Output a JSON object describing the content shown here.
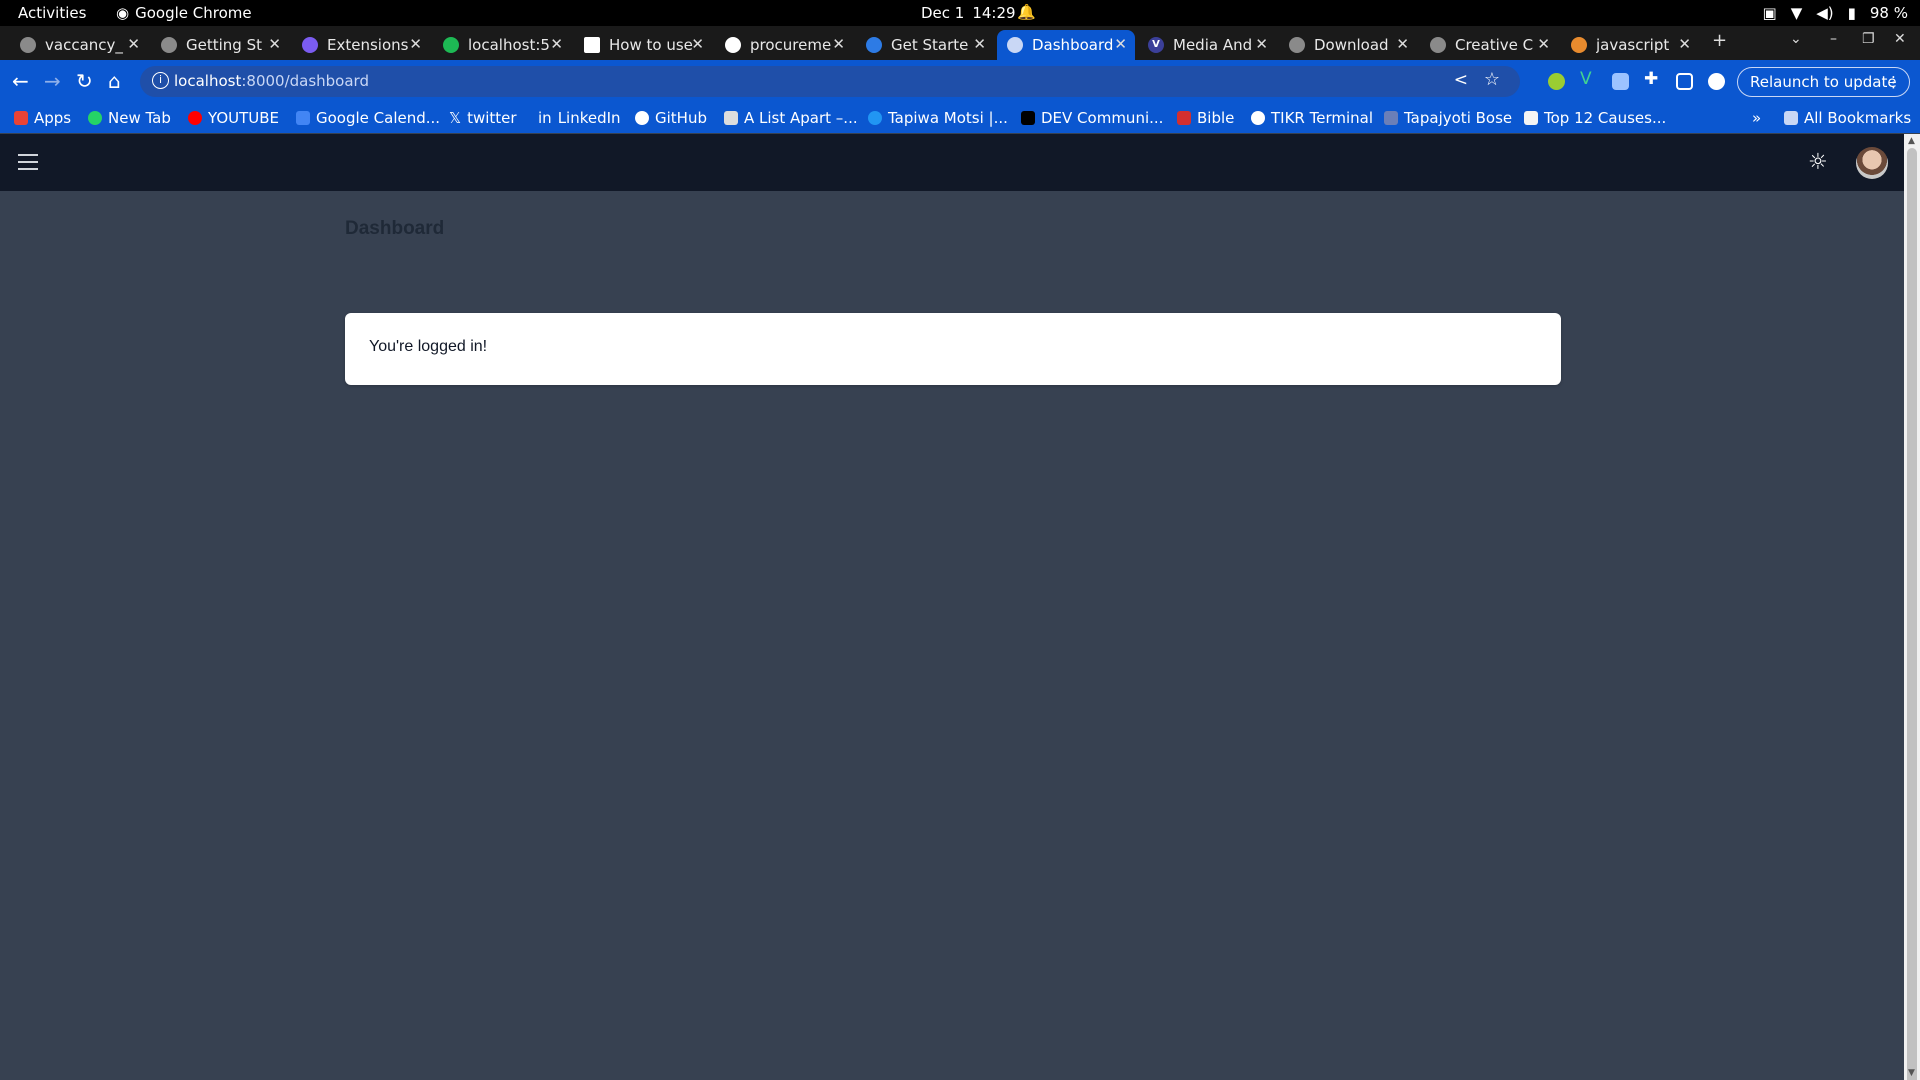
{
  "os_bar": {
    "activities": "Activities",
    "app_name": "Google Chrome",
    "date": "Dec 1",
    "time": "14:29",
    "battery": "98 %"
  },
  "tabs": [
    {
      "title": "vaccancy_",
      "active": false
    },
    {
      "title": "Getting St",
      "active": false
    },
    {
      "title": "Extensions",
      "active": false
    },
    {
      "title": "localhost:5",
      "active": false
    },
    {
      "title": "How to use",
      "active": false
    },
    {
      "title": "procureme",
      "active": false
    },
    {
      "title": "Get Starte",
      "active": false
    },
    {
      "title": "Dashboard",
      "active": true
    },
    {
      "title": "Media And",
      "active": false
    },
    {
      "title": "Download",
      "active": false
    },
    {
      "title": "Creative C",
      "active": false
    },
    {
      "title": "javascript",
      "active": false
    }
  ],
  "address_bar": {
    "host": "localhost",
    "path": ":8000/dashboard"
  },
  "relaunch_label": "Relaunch to update",
  "bookmarks": {
    "items": [
      "Apps",
      "New Tab",
      "YOUTUBE",
      "Google Calend...",
      "twitter",
      "LinkedIn",
      "GitHub",
      "A List Apart –...",
      "Tapiwa Motsi |...",
      "DEV Communi...",
      "Bible",
      "TIKR Terminal",
      "Tapajyoti Bose",
      "Top 12 Causes..."
    ],
    "all_bookmarks": "All Bookmarks"
  },
  "page": {
    "title": "Dashboard",
    "message": "You're logged in!"
  },
  "colors": {
    "chrome_blue": "#0b57d0",
    "app_nav": "#111827",
    "page_bg": "#374151",
    "card_bg": "#ffffff"
  }
}
